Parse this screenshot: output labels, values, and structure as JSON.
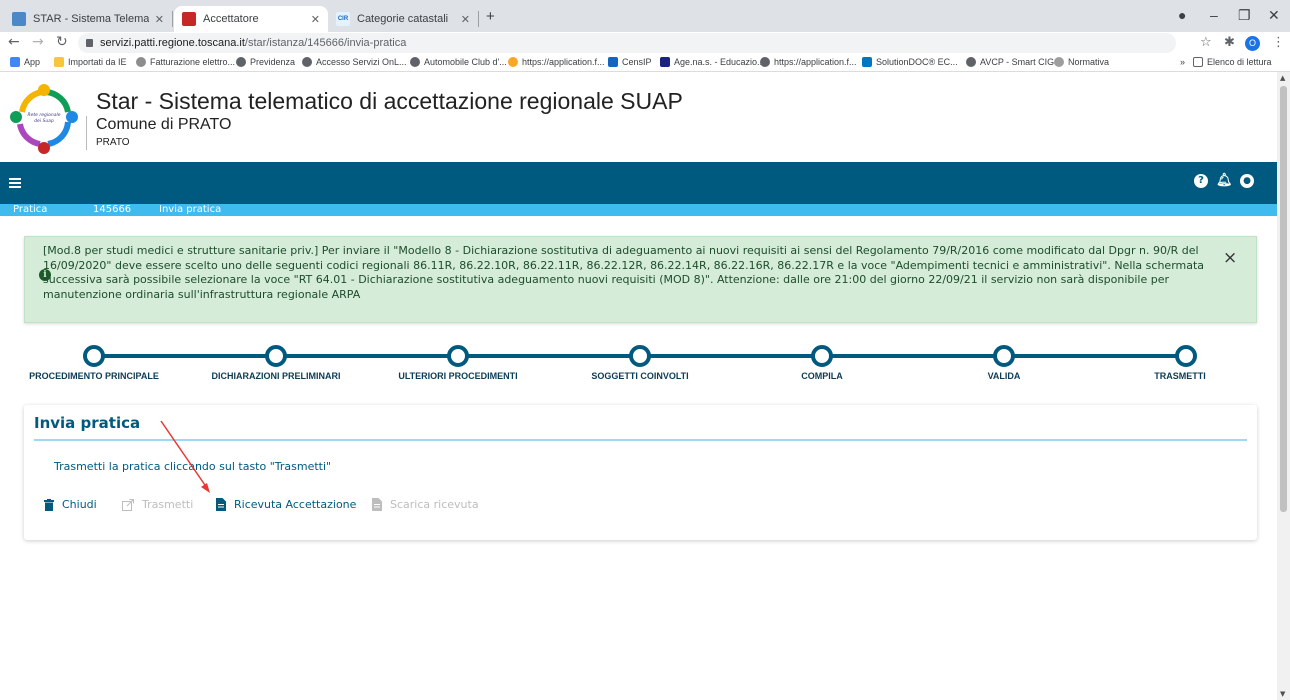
{
  "browser": {
    "tabs": [
      {
        "title": "STAR - Sistema Telematico di Acce",
        "favicon_color": "#4a88c7",
        "active": false
      },
      {
        "title": "Accettatore",
        "favicon_color": "#c62828",
        "active": true
      },
      {
        "title": "Categorie catastali",
        "favicon_color": "#1565c0",
        "favicon_text": "CIR",
        "active": false
      }
    ],
    "new_tab": "+",
    "url_host": "servizi.patti.regione.toscana.it",
    "url_path": "/star/istanza/145666/invia-pratica",
    "profile_initial": "O",
    "bookmarks": [
      {
        "label": "App",
        "color": "#4285f4"
      },
      {
        "label": "Importati da IE",
        "color": "#f9c440"
      },
      {
        "label": "Fatturazione elettro...",
        "color": "#8d8d8d"
      },
      {
        "label": "Previdenza",
        "color": "#5f6368"
      },
      {
        "label": "Accesso Servizi OnL...",
        "color": "#5f6368"
      },
      {
        "label": "Automobile Club d'...",
        "color": "#5f6368"
      },
      {
        "label": "https://application.f...",
        "color": "#f9a825"
      },
      {
        "label": "CensIP",
        "color": "#1565c0"
      },
      {
        "label": "Age.na.s. - Educazio...",
        "color": "#1a237e"
      },
      {
        "label": "https://application.f...",
        "color": "#5f6368"
      },
      {
        "label": "SolutionDOC® EC...",
        "color": "#0277bd"
      },
      {
        "label": "AVCP - Smart CIG",
        "color": "#5f6368"
      },
      {
        "label": "Normativa",
        "color": "#9e9e9e"
      }
    ],
    "reading_list": "Elenco di lettura"
  },
  "header": {
    "title": "Star - Sistema telematico di accettazione regionale SUAP",
    "subtitle": "Comune di PRATO",
    "city": "PRATO",
    "logo_text": "Rete regionale dei Suap"
  },
  "breadcrumb": [
    "Pratica",
    "145666",
    "Invia pratica"
  ],
  "alert": {
    "text": "[Mod.8 per studi medici e strutture sanitarie priv.] Per inviare il \"Modello 8 - Dichiarazione sostitutiva di adeguamento ai nuovi requisiti ai sensi del Regolamento 79/R/2016 come modificato dal Dpgr n. 90/R del 16/09/2020\" deve essere scelto uno delle seguenti codici regionali 86.11R, 86.22.10R, 86.22.11R, 86.22.12R, 86.22.14R, 86.22.16R, 86.22.17R e la voce \"Adempimenti tecnici e amministrativi\". Nella schermata successiva sarà possibile selezionare la voce \"RT 64.01 - Dichiarazione sostitutiva adeguamento nuovi requisiti (MOD 8)\". Attenzione: dalle ore 21:00 del giorno 22/09/21 il servizio non sarà disponibile per manutenzione ordinaria sull'infrastruttura regionale ARPA",
    "close": "×",
    "bg_color": "#d4ecd8"
  },
  "steps": [
    {
      "label": "PROCEDIMENTO PRINCIPALE"
    },
    {
      "label": "DICHIARAZIONI PRELIMINARI"
    },
    {
      "label": "ULTERIORI PROCEDIMENTI"
    },
    {
      "label": "SOGGETTI COINVOLTI"
    },
    {
      "label": "COMPILA"
    },
    {
      "label": "VALIDA"
    },
    {
      "label": "TRASMETTI"
    }
  ],
  "card": {
    "title": "Invia pratica",
    "description": "Trasmetti la pratica cliccando sul tasto \"Trasmetti\"",
    "actions": [
      {
        "label": "Chiudi",
        "icon": "trash-icon",
        "enabled": true
      },
      {
        "label": "Trasmetti",
        "icon": "external-link-icon",
        "enabled": false
      },
      {
        "label": "Ricevuta Accettazione",
        "icon": "document-icon",
        "enabled": true
      },
      {
        "label": "Scarica ricevuta",
        "icon": "document-icon",
        "enabled": false
      }
    ]
  },
  "colors": {
    "primary": "#005a7f",
    "breadcrumb_bar": "#3fbbee",
    "annotation_arrow": "#e53935"
  }
}
